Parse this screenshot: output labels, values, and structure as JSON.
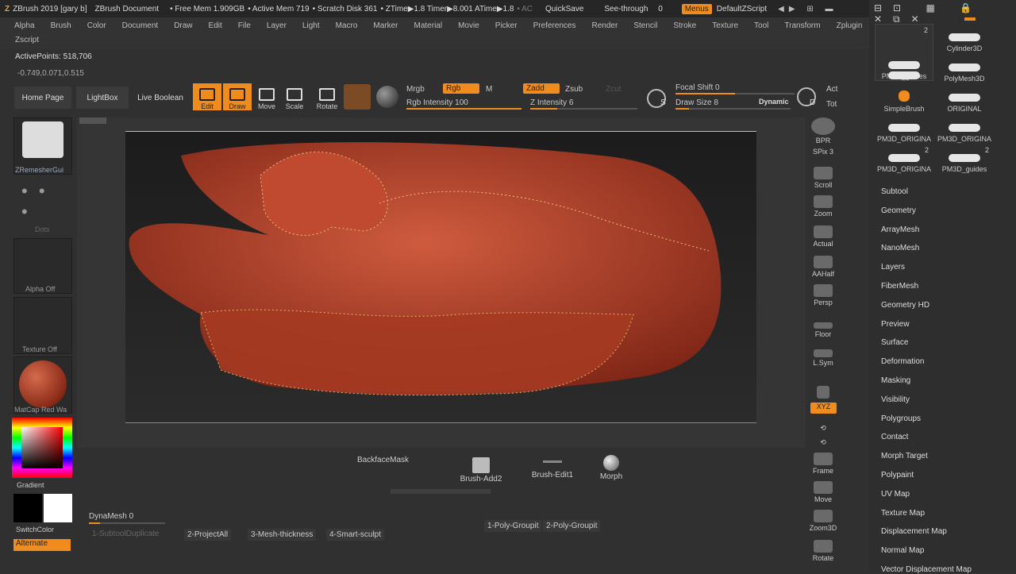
{
  "title": {
    "app": "ZBrush 2019 [gary b]",
    "doc": "ZBrush Document",
    "free_mem": "• Free Mem 1.909GB",
    "active_mem": "• Active Mem 719",
    "scratch": "• Scratch Disk 361",
    "ztime": "• ZTime▶1.8 Timer▶8.001 ATime▶1.8",
    "ac": "• AC",
    "quicksave": "QuickSave",
    "seethrough": "See-through",
    "seethrough_value": "0",
    "menus": "Menus",
    "script": "DefaultZScript"
  },
  "menu": [
    "Alpha",
    "Brush",
    "Color",
    "Document",
    "Draw",
    "Edit",
    "File",
    "Layer",
    "Light",
    "Macro",
    "Marker",
    "Material",
    "Movie",
    "Picker",
    "Preferences",
    "Render",
    "Stencil",
    "Stroke",
    "Texture",
    "Tool",
    "Transform",
    "Zplugin"
  ],
  "menu2": "Zscript",
  "active_points": "ActivePoints: 518,706",
  "coords": "-0.749,0.071,0.515",
  "nav": {
    "home": "Home Page",
    "lightbox": "LightBox",
    "liveboolean": "Live Boolean"
  },
  "tools": {
    "edit": "Edit",
    "draw": "Draw",
    "move": "Move",
    "scale": "Scale",
    "rotate": "Rotate"
  },
  "paint": {
    "mrgb": "Mrgb",
    "rgb": "Rgb",
    "m": "M",
    "rgb_intensity": "Rgb Intensity 100",
    "zadd": "Zadd",
    "zsub": "Zsub",
    "zcut": "Zcut",
    "z_intensity": "Z Intensity 6",
    "focal_shift": "Focal Shift 0",
    "draw_size": "Draw Size 8",
    "dynamic": "Dynamic",
    "act": "Act",
    "tot": "Tot",
    "s_letter": "S",
    "d_letter": "D"
  },
  "leftshelf": {
    "zremesher": "ZRemesherGui",
    "dots": "Dots",
    "alpha": "Alpha Off",
    "texture": "Texture Off",
    "matcap": "MatCap Red Wa",
    "gradient": "Gradient",
    "switchcolor": "SwitchColor",
    "alternate": "Alternate"
  },
  "rightshelf": [
    "BPR",
    "SPix 3",
    "Scroll",
    "Zoom",
    "Actual",
    "AAHalf",
    "Persp",
    "Floor",
    "L.Sym",
    "",
    "XYZ",
    "",
    "",
    "Frame",
    "Move",
    "Zoom3D",
    "Rotate"
  ],
  "bottom": {
    "backface": "BackfaceMask",
    "brush_add": "Brush-Add2",
    "brush_edit": "Brush-Edit1",
    "morph": "Morph",
    "dynamesh": "DynaMesh",
    "dynamesh_value": "0",
    "subtool_dup": "1-SubtoolDuplicate",
    "project": "2-ProjectAll",
    "meshthick": "3-Mesh-thickness",
    "smartsculpt": "4-Smart-sculpt",
    "polygroupit1": "1-Poly-Groupit",
    "polygroupit2": "2-Poly-Groupit"
  },
  "toolthumbs": [
    {
      "label": "PM3D_guides",
      "count": "2"
    },
    {
      "label": "Cylinder3D",
      "count": ""
    },
    {
      "label": "",
      "count": ""
    },
    {
      "label": "PolyMesh3D",
      "count": ""
    },
    {
      "label": "SimpleBrush",
      "count": ""
    },
    {
      "label": "ORIGINAL",
      "count": ""
    },
    {
      "label": "PM3D_ORIGINA",
      "count": ""
    },
    {
      "label": "PM3D_ORIGINA",
      "count": ""
    },
    {
      "label": "PM3D_ORIGINA",
      "count": "2"
    },
    {
      "label": "PM3D_guides",
      "count": "2"
    }
  ],
  "toolpanel": [
    "Subtool",
    "Geometry",
    "ArrayMesh",
    "NanoMesh",
    "Layers",
    "FiberMesh",
    "Geometry HD",
    "Preview",
    "Surface",
    "Deformation",
    "Masking",
    "Visibility",
    "Polygroups",
    "Contact",
    "Morph Target",
    "Polypaint",
    "UV Map",
    "Texture Map",
    "Displacement Map",
    "Normal Map",
    "Vector Displacement Map"
  ],
  "colors": {
    "accent": "#f08c1e",
    "model": "#b0402a"
  }
}
